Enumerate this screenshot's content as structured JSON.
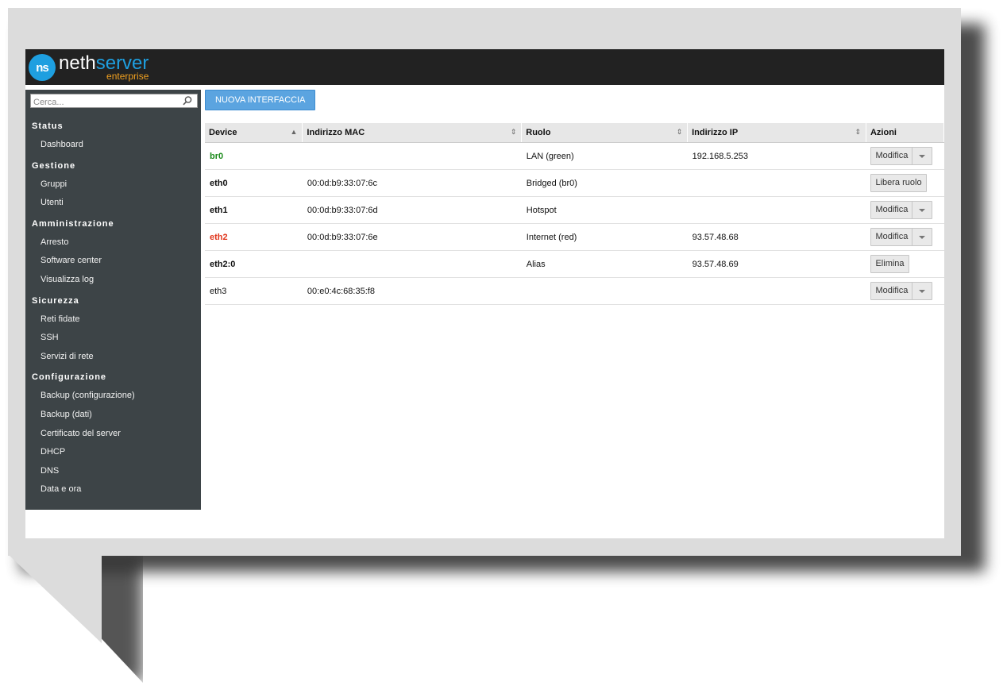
{
  "app": {
    "logo_badge": "ns",
    "logo_main_1": "neth",
    "logo_main_2": "server",
    "logo_sub": "enterprise",
    "brand_color": "#1e9fe0",
    "accent_color": "#f0a020"
  },
  "sidebar": {
    "search_placeholder": "Cerca...",
    "search_icon": "search-icon",
    "sections": [
      {
        "title": "Status",
        "items": [
          "Dashboard"
        ]
      },
      {
        "title": "Gestione",
        "items": [
          "Gruppi",
          "Utenti"
        ]
      },
      {
        "title": "Amministrazione",
        "items": [
          "Arresto",
          "Software center",
          "Visualizza log"
        ]
      },
      {
        "title": "Sicurezza",
        "items": [
          "Reti fidate",
          "SSH",
          "Servizi di rete"
        ]
      },
      {
        "title": "Configurazione",
        "items": [
          "Backup (configurazione)",
          "Backup (dati)",
          "Certificato del server",
          "DHCP",
          "DNS",
          "Data e ora"
        ]
      }
    ]
  },
  "main": {
    "new_button": "NUOVA INTERFACCIA",
    "columns": [
      "Device",
      "Indirizzo MAC",
      "Ruolo",
      "Indirizzo IP",
      "Azioni"
    ],
    "rows": [
      {
        "device": "br0",
        "mac": "",
        "role": "LAN (green)",
        "ip": "192.168.5.253",
        "action": "Modifica",
        "dropdown": true,
        "style": "green"
      },
      {
        "device": "eth0",
        "mac": "00:0d:b9:33:07:6c",
        "role": "Bridged (br0)",
        "ip": "",
        "action": "Libera ruolo",
        "dropdown": false,
        "style": "bold"
      },
      {
        "device": "eth1",
        "mac": "00:0d:b9:33:07:6d",
        "role": "Hotspot",
        "ip": "",
        "action": "Modifica",
        "dropdown": true,
        "style": "bold"
      },
      {
        "device": "eth2",
        "mac": "00:0d:b9:33:07:6e",
        "role": "Internet (red)",
        "ip": "93.57.48.68",
        "action": "Modifica",
        "dropdown": true,
        "style": "red"
      },
      {
        "device": "eth2:0",
        "mac": "",
        "role": "Alias",
        "ip": "93.57.48.69",
        "action": "Elimina",
        "dropdown": false,
        "style": "bold"
      },
      {
        "device": "eth3",
        "mac": "00:e0:4c:68:35:f8",
        "role": "",
        "ip": "",
        "action": "Modifica",
        "dropdown": true,
        "style": "plain"
      }
    ]
  }
}
